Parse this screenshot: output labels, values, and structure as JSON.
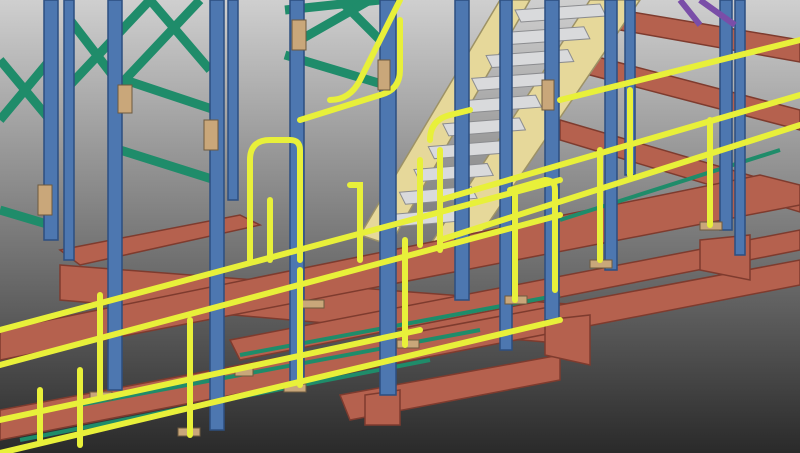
{
  "scene": {
    "subject": "steel-platform-stair-3d-model",
    "colors": {
      "background_top": "#cfcfcf",
      "background_bottom": "#2a2a2a",
      "beam": "#b5614e",
      "beam_dark": "#7e3b2e",
      "column": "#4d77b0",
      "column_dark": "#2d4f80",
      "bracing": "#1f8c6a",
      "handrail": "#e8f03a",
      "handrail_dark": "#a9ad1d",
      "stair_stringer": "#e6d89a",
      "grating": "#d9dadc",
      "plate": "#c9a77a",
      "accent_purple": "#7a4ea8"
    }
  }
}
